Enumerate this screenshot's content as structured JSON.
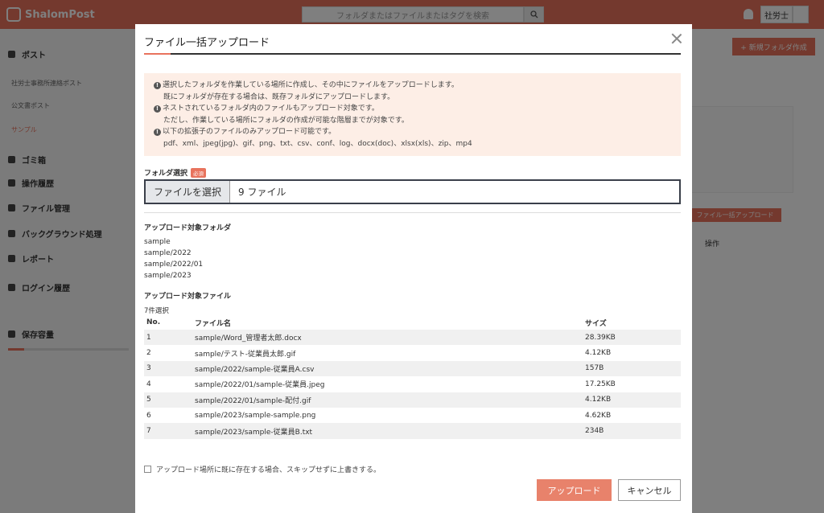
{
  "app": {
    "logo_text": "ShalomPost",
    "search_placeholder": "フォルダまたはファイルまたはタグを検索",
    "user_label": "社労士",
    "new_folder_button": "+ 新規フォルダ作成",
    "bulk_upload_button": "ファイル一括アップロード",
    "op_header": "操作",
    "sidebar": [
      {
        "label": "ポスト"
      },
      {
        "label": "ゴミ箱"
      },
      {
        "label": "操作履歴"
      },
      {
        "label": "ファイル管理"
      },
      {
        "label": "バックグラウンド処理"
      },
      {
        "label": "レポート"
      },
      {
        "label": "ログイン履歴"
      },
      {
        "label": "保存容量"
      }
    ],
    "sidebar_sub": [
      "社労士事務所連絡ポスト",
      "公文書ポスト",
      "サンプル"
    ]
  },
  "modal": {
    "title": "ファイル一括アップロード",
    "info": [
      {
        "icon": true,
        "text": "選択したフォルダを作業している場所に作成し、その中にファイルをアップロードします。"
      },
      {
        "icon": false,
        "text": "既にフォルダが存在する場合は、既存フォルダにアップロードします。"
      },
      {
        "icon": true,
        "text": "ネストされているフォルダ内のファイルもアップロード対象です。"
      },
      {
        "icon": false,
        "text": "ただし、作業している場所にフォルダの作成が可能な階層までが対象です。"
      },
      {
        "icon": true,
        "text": "以下の拡張子のファイルのみアップロード可能です。"
      },
      {
        "icon": false,
        "text": "pdf、xml、jpeg(jpg)、gif、png、txt、csv、conf、log、docx(doc)、xlsx(xls)、zip、mp4"
      }
    ],
    "folder_select_label": "フォルダ選択",
    "required_badge": "必須",
    "file_select_button": "ファイルを選択",
    "file_count": "9 ファイル",
    "target_folders_title": "アップロード対象フォルダ",
    "target_folders": [
      "sample",
      "sample/2022",
      "sample/2022/01",
      "sample/2023"
    ],
    "target_files_title": "アップロード対象ファイル",
    "selected_count": "7件選択",
    "table_headers": {
      "no": "No.",
      "name": "ファイル名",
      "size": "サイズ"
    },
    "files": [
      {
        "no": "1",
        "name": "sample/Word_管理者太郎.docx",
        "size": "28.39KB"
      },
      {
        "no": "2",
        "name": "sample/テスト-従業員太郎.gif",
        "size": "4.12KB"
      },
      {
        "no": "3",
        "name": "sample/2022/sample-従業員A.csv",
        "size": "157B"
      },
      {
        "no": "4",
        "name": "sample/2022/01/sample-従業員.jpeg",
        "size": "17.25KB"
      },
      {
        "no": "5",
        "name": "sample/2022/01/sample-配付.gif",
        "size": "4.12KB"
      },
      {
        "no": "6",
        "name": "sample/2023/sample-sample.png",
        "size": "4.62KB"
      },
      {
        "no": "7",
        "name": "sample/2023/sample-従業員B.txt",
        "size": "234B"
      }
    ],
    "overwrite_label": "アップロード場所に既に存在する場合、スキップせずに上書きする。",
    "upload_button": "アップロード",
    "cancel_button": "キャンセル"
  },
  "colors": {
    "accent": "#e8735d",
    "info_bg": "#fdeee6"
  }
}
